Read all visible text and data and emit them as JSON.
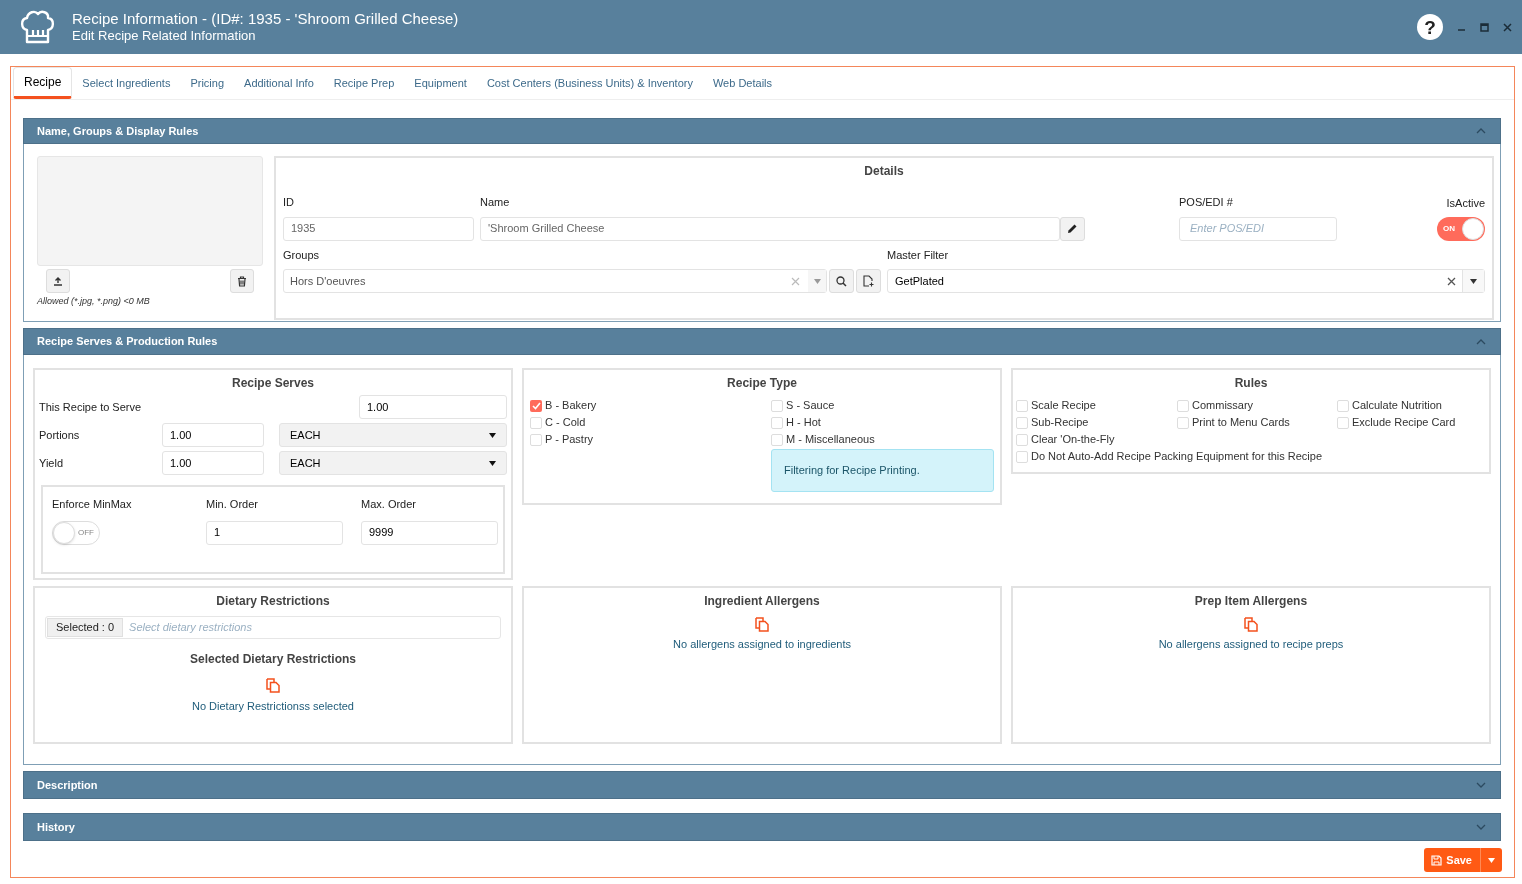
{
  "window": {
    "title": "Recipe Information - (ID#: 1935 - 'Shroom Grilled Cheese)",
    "subtitle": "Edit Recipe Related Information",
    "help": "?"
  },
  "tabs": [
    {
      "label": "Recipe",
      "selected": true
    },
    {
      "label": "Select Ingredients",
      "selected": false
    },
    {
      "label": "Pricing",
      "selected": false
    },
    {
      "label": "Additional Info",
      "selected": false
    },
    {
      "label": "Recipe Prep",
      "selected": false
    },
    {
      "label": "Equipment",
      "selected": false
    },
    {
      "label": "Cost Centers (Business Units) & Inventory",
      "selected": false
    },
    {
      "label": "Web Details",
      "selected": false
    }
  ],
  "name_section": {
    "title": "Name, Groups & Display Rules",
    "expanded": true,
    "image": {
      "allowed_note": "Allowed (*.jpg, *.png) <0 MB"
    },
    "details": {
      "title": "Details",
      "id": {
        "label": "ID",
        "value": "1935"
      },
      "name": {
        "label": "Name",
        "value": "'Shroom Grilled Cheese"
      },
      "pos_edi": {
        "label": "POS/EDI #",
        "placeholder": "Enter POS/EDI"
      },
      "is_active": {
        "label": "IsActive",
        "on": true,
        "toggle_text": "ON"
      },
      "groups": {
        "label": "Groups",
        "value": "Hors D'oeuvres"
      },
      "master_filter": {
        "label": "Master Filter",
        "value": "GetPlated"
      }
    }
  },
  "serves_section": {
    "title": "Recipe Serves & Production Rules",
    "expanded": true,
    "recipe_serves": {
      "title": "Recipe Serves",
      "this_recipe_to_serve": {
        "label": "This Recipe to Serve",
        "value": "1.00"
      },
      "portions": {
        "label": "Portions",
        "value": "1.00",
        "unit": "EACH"
      },
      "yield": {
        "label": "Yield",
        "value": "1.00",
        "unit": "EACH"
      },
      "enforce_minmax": {
        "label": "Enforce MinMax",
        "on": false,
        "toggle_text": "OFF"
      },
      "min_order": {
        "label": "Min. Order",
        "value": "1"
      },
      "max_order": {
        "label": "Max. Order",
        "value": "9999"
      }
    },
    "recipe_type": {
      "title": "Recipe Type",
      "columns": [
        [
          {
            "label": "B - Bakery",
            "checked": true
          },
          {
            "label": "C - Cold",
            "checked": false
          },
          {
            "label": "P - Pastry",
            "checked": false
          }
        ],
        [
          {
            "label": "S - Sauce",
            "checked": false
          },
          {
            "label": "H - Hot",
            "checked": false
          },
          {
            "label": "M - Miscellaneous",
            "checked": false
          }
        ]
      ],
      "note": "Filtering for Recipe Printing."
    },
    "rules": {
      "title": "Rules",
      "items": [
        {
          "label": "Scale Recipe",
          "checked": false
        },
        {
          "label": "Commissary",
          "checked": false
        },
        {
          "label": "Calculate Nutrition",
          "checked": false
        },
        {
          "label": "Sub-Recipe",
          "checked": false
        },
        {
          "label": "Print to Menu Cards",
          "checked": false
        },
        {
          "label": "Exclude Recipe Card",
          "checked": false
        }
      ],
      "wide_items": [
        {
          "label": "Clear 'On-the-Fly",
          "checked": false
        },
        {
          "label": "Do Not Auto-Add Recipe Packing Equipment for this Recipe",
          "checked": false
        }
      ]
    },
    "dietary_restrictions": {
      "title": "Dietary Restrictions",
      "selected_count": "Selected : 0",
      "placeholder": "Select dietary restrictions",
      "selected_title": "Selected Dietary Restrictions",
      "empty_message": "No Dietary Restrictionss selected"
    },
    "ingredient_allergens": {
      "title": "Ingredient Allergens",
      "empty_message": "No allergens assigned to ingredients"
    },
    "prep_item_allergens": {
      "title": "Prep Item Allergens",
      "empty_message": "No allergens assigned to recipe preps"
    }
  },
  "collapsed_sections": [
    {
      "title": "Description",
      "expanded": false
    },
    {
      "title": "History",
      "expanded": false
    }
  ],
  "save_button": {
    "label": "Save"
  }
}
